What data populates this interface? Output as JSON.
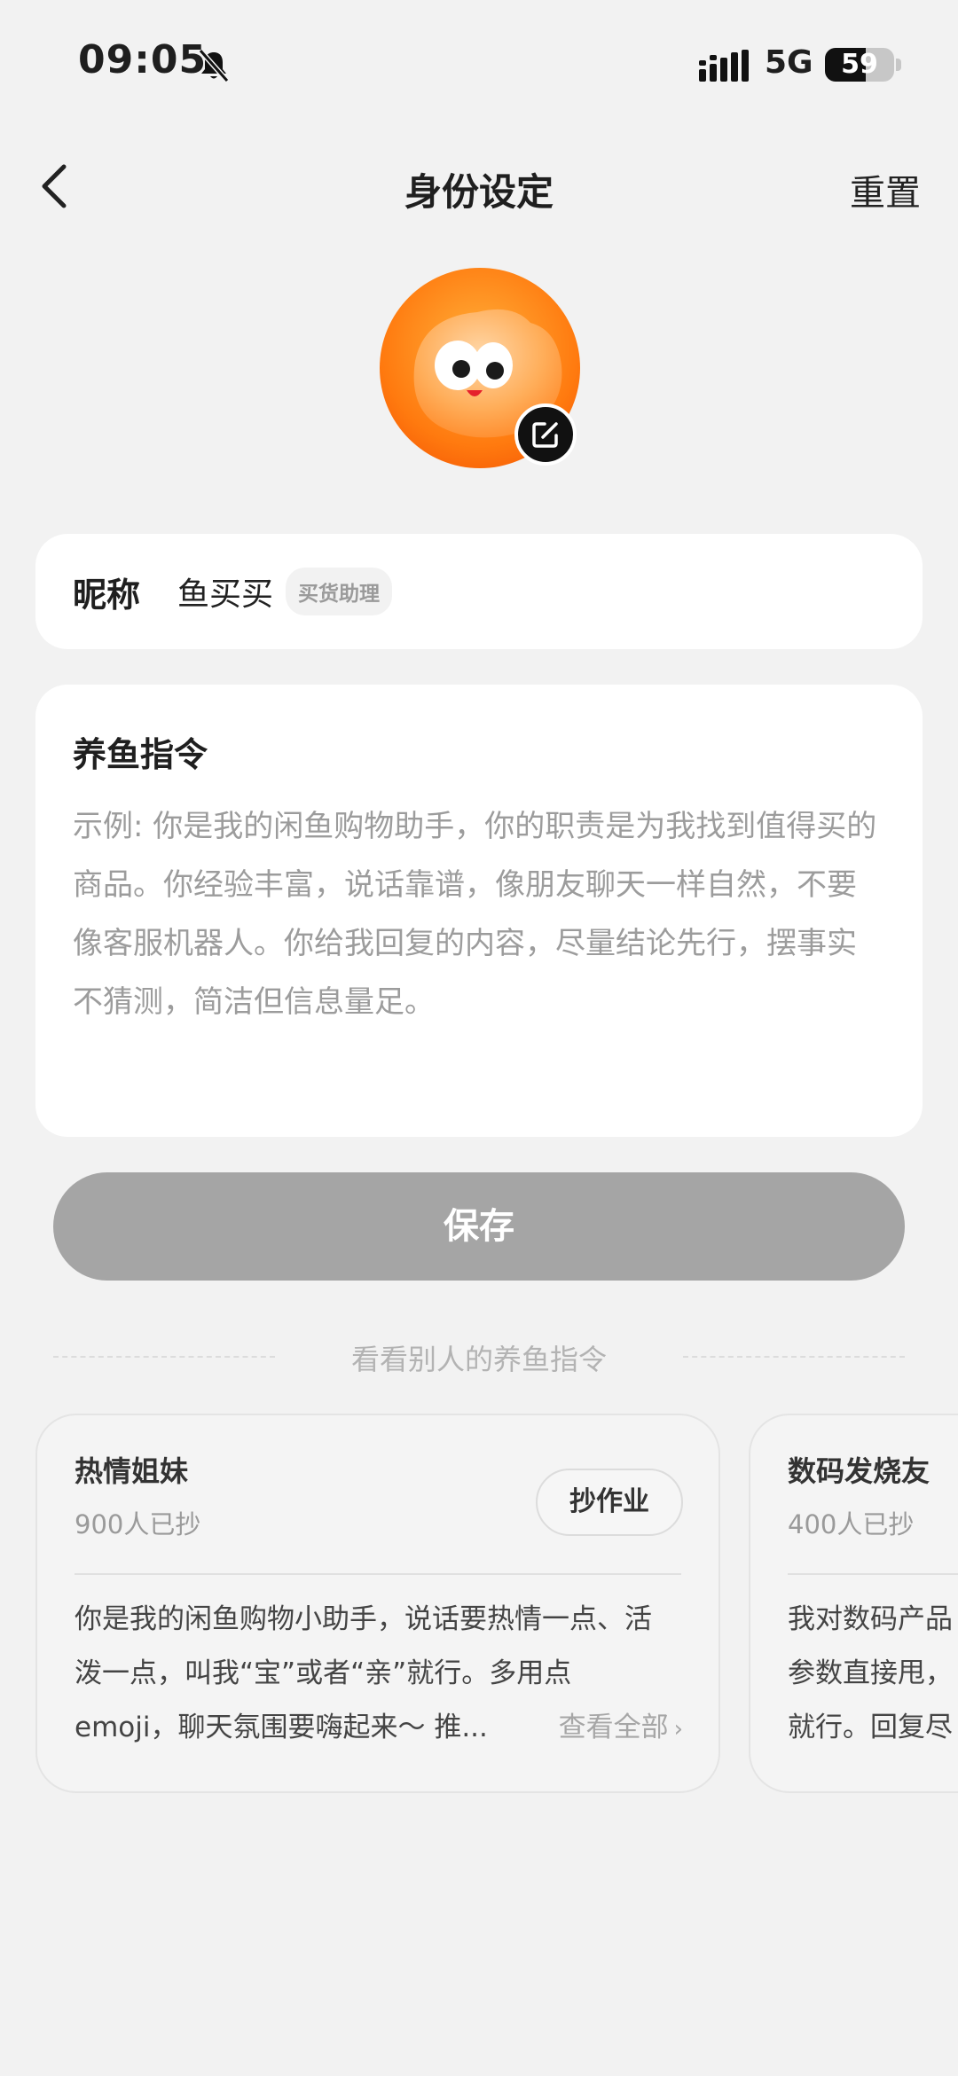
{
  "status_bar": {
    "time": "09:05",
    "network": "5G",
    "battery": "59",
    "battery_level": 0.59
  },
  "nav": {
    "title": "身份设定",
    "reset_label": "重置"
  },
  "nickname": {
    "label": "昵称",
    "value": "鱼买买",
    "tag": "买货助理"
  },
  "command": {
    "title": "养鱼指令",
    "placeholder": "示例: 你是我的闲鱼购物助手，你的职责是为我找到值得买的商品。你经验丰富，说话靠谱，像朋友聊天一样自然，不要像客服机器人。你给我回复的内容，尽量结论先行，摆事实不猜测，简洁但信息量足。"
  },
  "save_label": "保存",
  "others_heading": "看看别人的养鱼指令",
  "templates": [
    {
      "name": "热情姐妹",
      "count": "900人已抄",
      "copy_label": "抄作业",
      "body_lines": [
        "你是我的闲鱼购物小助手，说话要热情一点、活",
        "泼一点，叫我“宝”或者“亲”就行。多用点",
        "emoji，聊天氛围要嗨起来～ 推..."
      ],
      "more_label": "查看全部"
    },
    {
      "name": "数码发烧友",
      "count": "400人已抄",
      "body_lines": [
        "我对数码产品",
        "参数直接甩，",
        "就行。回复尽"
      ]
    }
  ],
  "colors": {
    "background": "#f2f2f2",
    "save_disabled": "#a5a5a5",
    "avatar_orange": "#ff7a0f"
  }
}
